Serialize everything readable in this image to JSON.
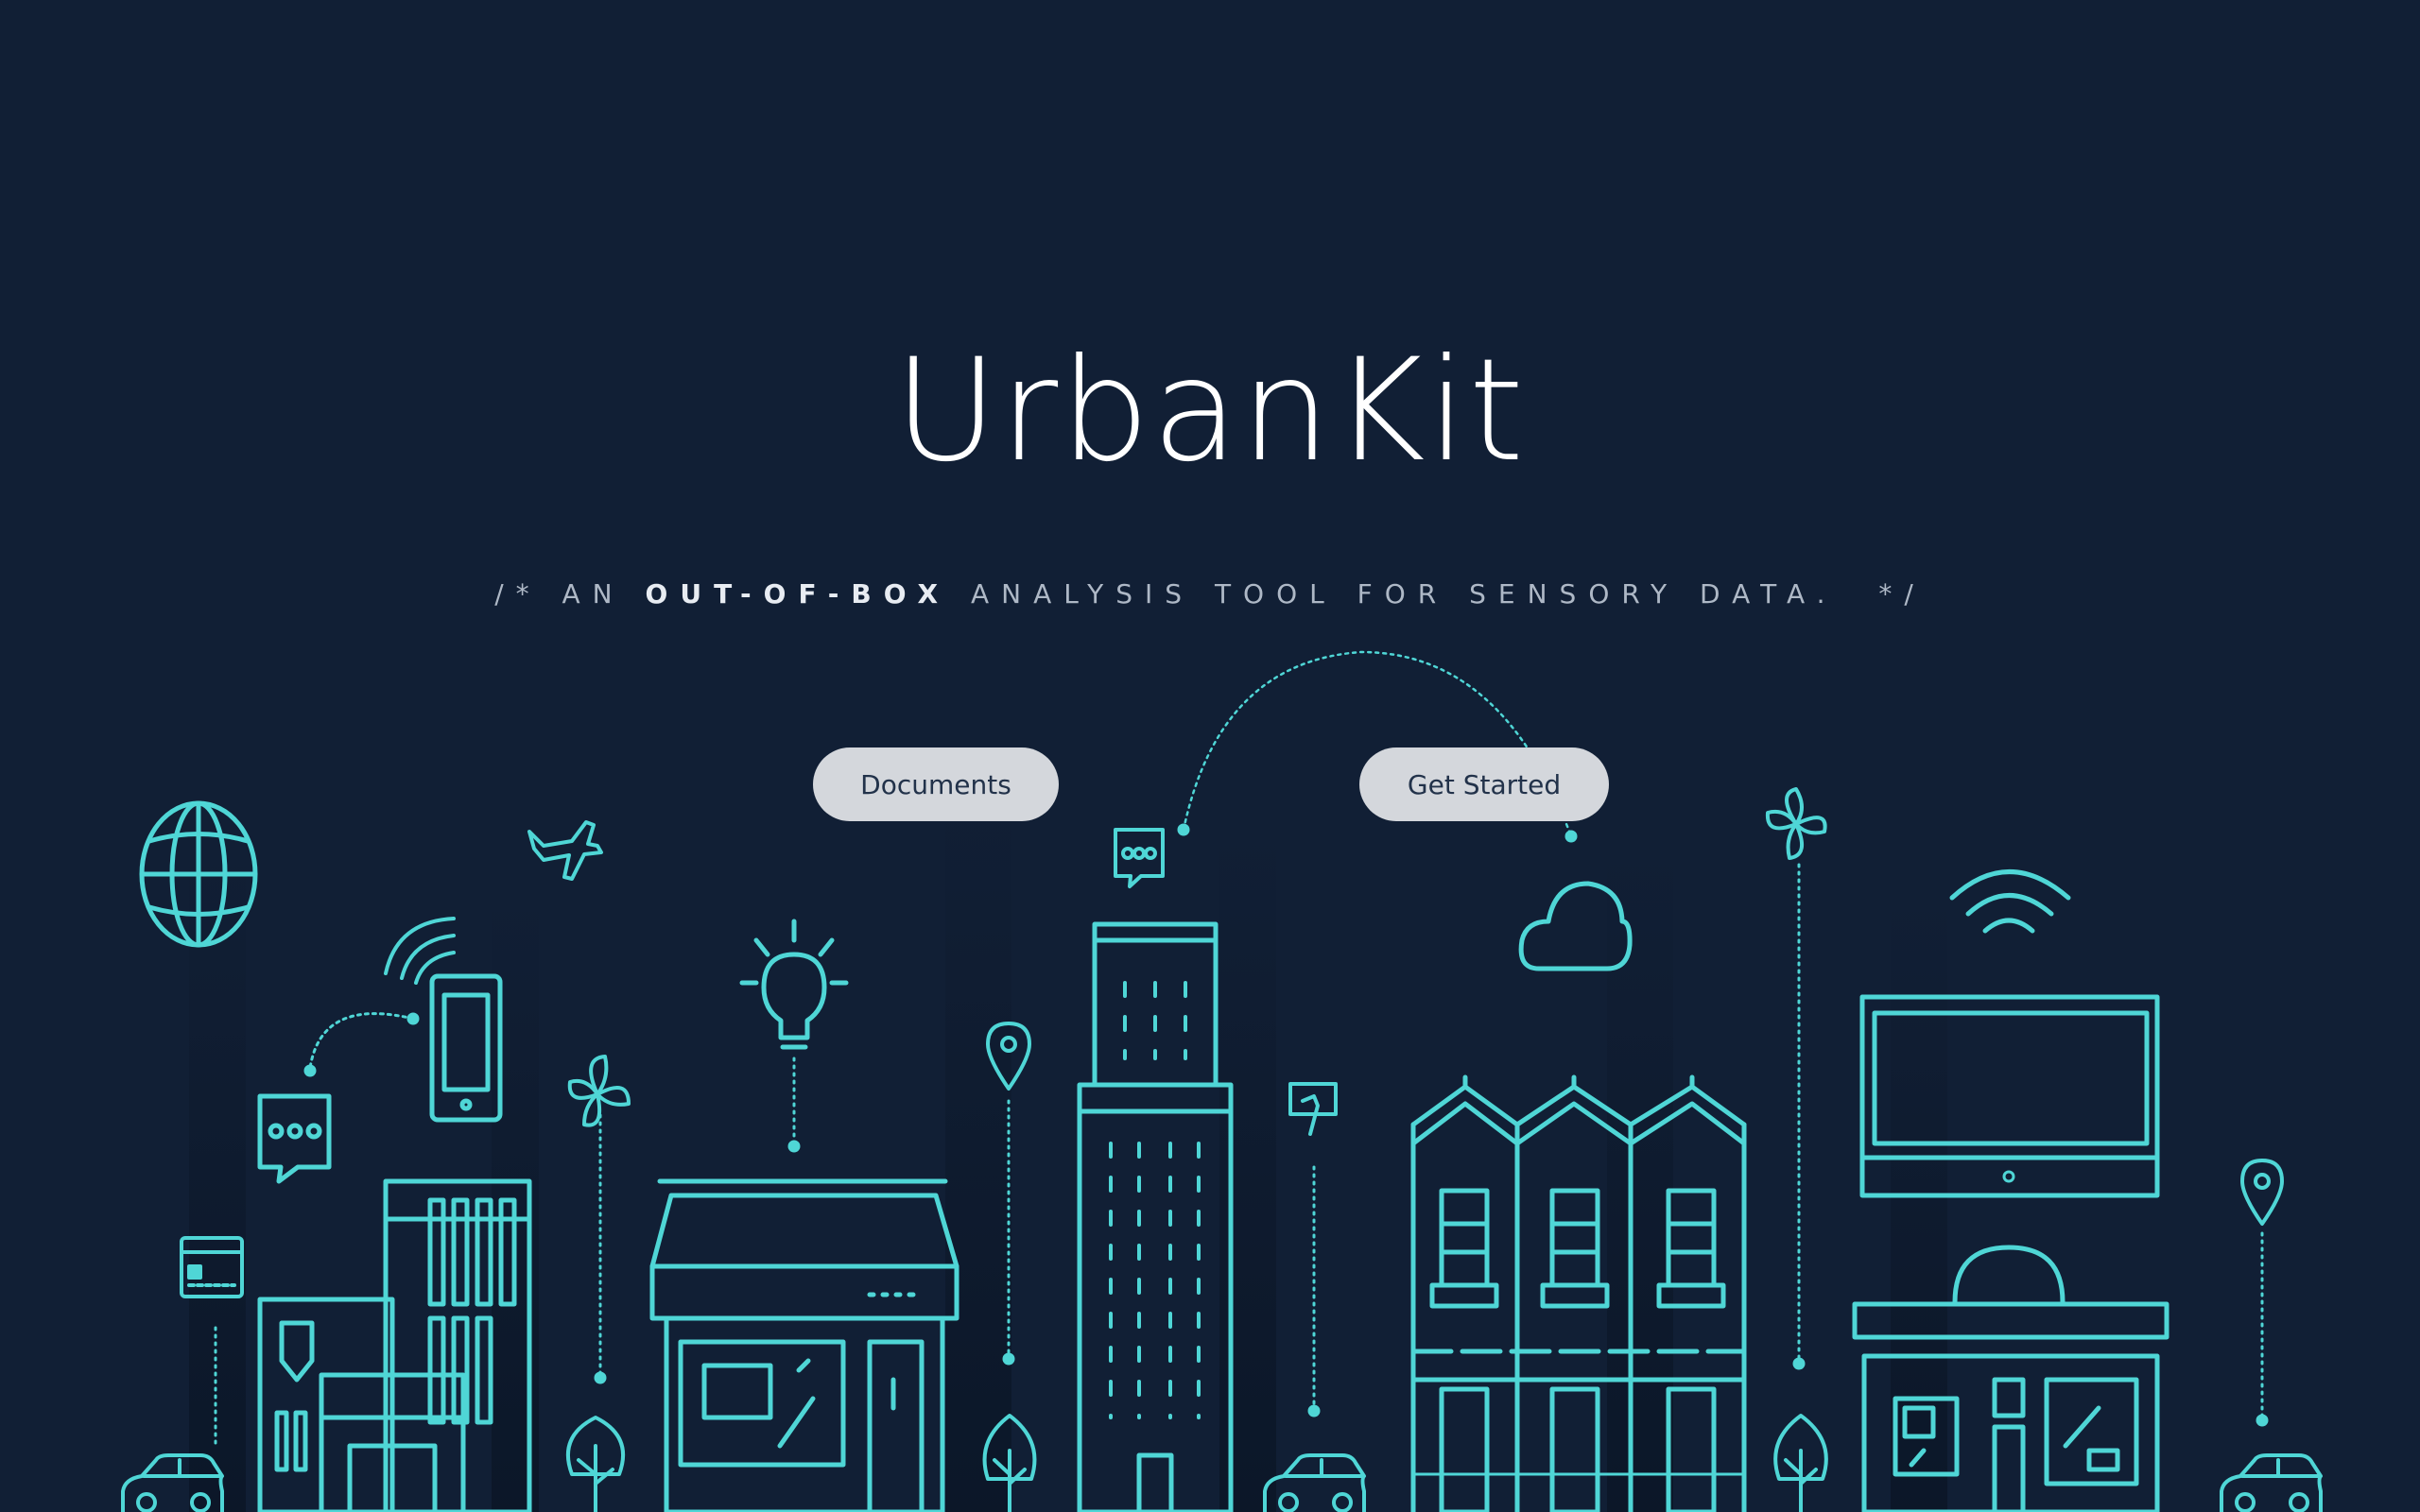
{
  "hero": {
    "title": "UrbanKit",
    "tagline": {
      "prefix": "/* AN ",
      "emphasis": "OUT-OF-BOX",
      "suffix": " ANALYSIS TOOL FOR SENSORY DATA.  */"
    }
  },
  "buttons": {
    "documents": "Documents",
    "get_started": "Get Started"
  },
  "illustration": {
    "stroke_color": "#4fd6d6",
    "background_color": "#111f35",
    "icons": [
      "globe-icon",
      "airplane-icon",
      "wifi-icon",
      "smartphone-icon",
      "chat-bubble-icon",
      "lightbulb-icon",
      "map-pin-icon",
      "pinwheel-icon",
      "cloud-icon",
      "monitor-icon",
      "credit-card-icon",
      "payment-terminal-icon",
      "tree-icon",
      "car-icon"
    ]
  }
}
